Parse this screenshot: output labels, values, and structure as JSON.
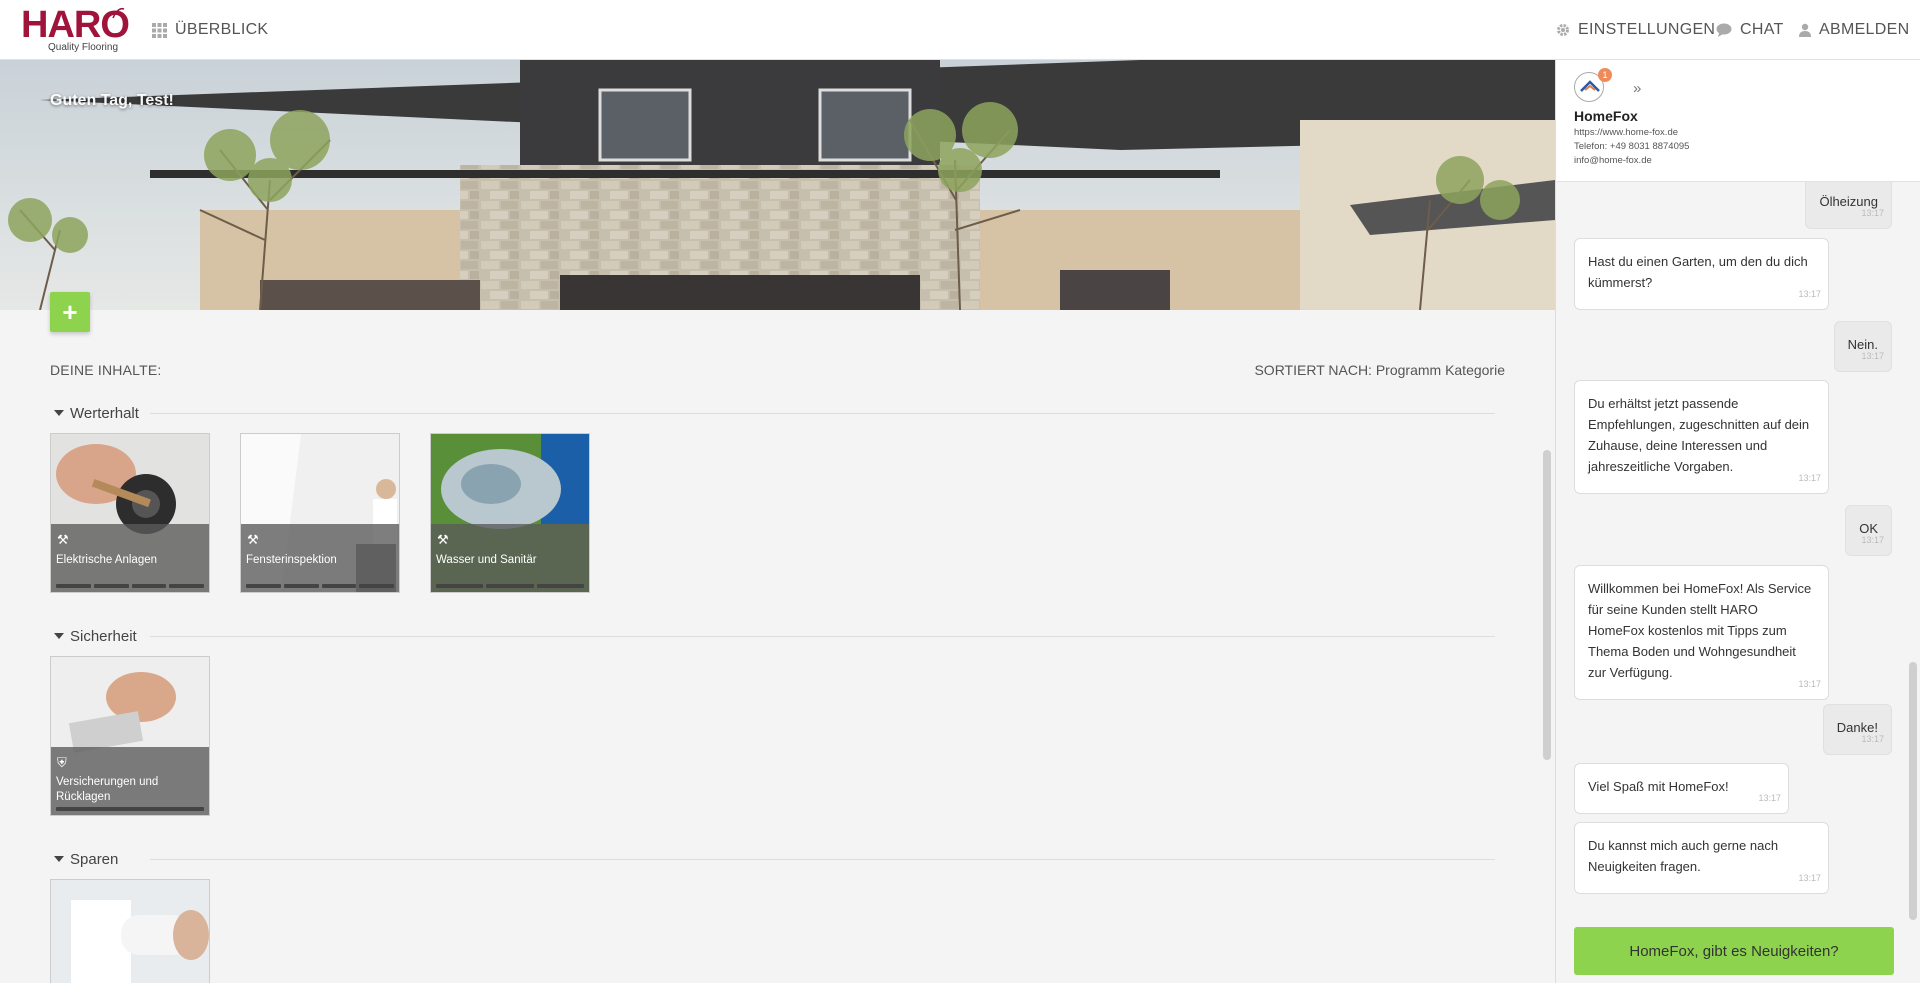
{
  "brand": {
    "name": "HARO",
    "tagline": "Quality Flooring"
  },
  "nav": {
    "overview": "ÜBERBLICK",
    "settings": "EINSTELLUNGEN",
    "chat": "CHAT",
    "logout": "ABMELDEN"
  },
  "hero": {
    "greeting": "Guten Tag, Test!",
    "add_label": "+"
  },
  "contents": {
    "heading": "DEINE INHALTE:",
    "sort_prefix": "SORTIERT NACH:",
    "sort_value": "Programm Kategorie",
    "sections": [
      {
        "title": "Werterhalt",
        "tiles": [
          {
            "label": "Elektrische Anlagen",
            "icon": "wrench-icon"
          },
          {
            "label": "Fensterinspektion",
            "icon": "wrench-icon"
          },
          {
            "label": "Wasser und Sanitär",
            "icon": "wrench-icon"
          }
        ]
      },
      {
        "title": "Sicherheit",
        "tiles": [
          {
            "label": "Versicherungen und Rücklagen",
            "icon": "shield-icon"
          }
        ]
      },
      {
        "title": "Sparen",
        "tiles": [
          {
            "label": "",
            "icon": "piggy-icon"
          }
        ]
      }
    ]
  },
  "chat": {
    "partner": {
      "name": "HomeFox",
      "badge": "1",
      "url": "https://www.home-fox.de",
      "phone": "Telefon: +49 8031 8874095",
      "email": "info@home-fox.de"
    },
    "messages": [
      {
        "dir": "out",
        "text": "Ölheizung",
        "time": "13:17"
      },
      {
        "dir": "in",
        "text": "Hast du einen Garten, um den du dich kümmerst?",
        "time": "13:17"
      },
      {
        "dir": "out",
        "text": "Nein.",
        "time": "13:17"
      },
      {
        "dir": "in",
        "text": "Du erhältst jetzt passende Empfehlungen, zugeschnitten auf dein Zuhause, deine Interessen und jahreszeitliche Vorgaben.",
        "time": "13:17"
      },
      {
        "dir": "out",
        "text": "OK",
        "time": "13:17"
      },
      {
        "dir": "in",
        "text": "Willkommen bei HomeFox! Als Service für seine Kunden stellt HARO HomeFox kostenlos mit Tipps zum Thema Boden und Wohngesundheit zur Verfügung.",
        "time": "13:17"
      },
      {
        "dir": "out",
        "text": "Danke!",
        "time": "13:17"
      },
      {
        "dir": "in",
        "text": "Viel Spaß mit HomeFox!",
        "time": "13:17"
      },
      {
        "dir": "in",
        "text": "Du kannst mich auch gerne nach Neuigkeiten fragen.",
        "time": "13:17"
      }
    ],
    "cta": "HomeFox, gibt es Neuigkeiten?"
  },
  "colors": {
    "brand": "#a0143c",
    "accent": "#8ed34d"
  }
}
